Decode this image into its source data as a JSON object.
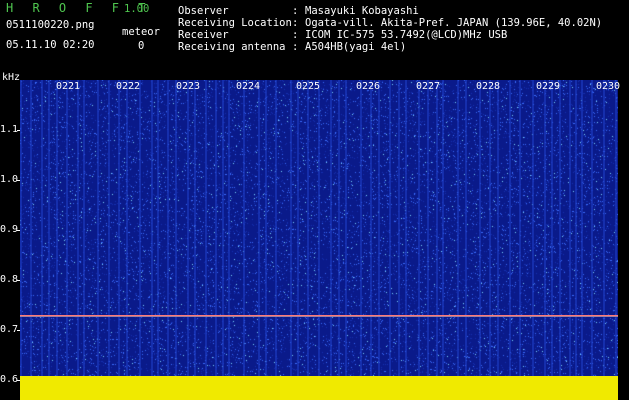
{
  "header": {
    "app_title": "H R O F F T",
    "version": "1.00",
    "filename": "0511100220.png",
    "datetime": "05.11.10 02:20",
    "meteor_label": "meteor",
    "meteor_count": "0",
    "info": [
      {
        "label": "Observer",
        "sep": ":",
        "value": "Masayuki Kobayashi"
      },
      {
        "label": "Receiving Location",
        "sep": ":",
        "value": "Ogata-vill. Akita-Pref. JAPAN (139.96E, 40.02N)"
      },
      {
        "label": "Receiver",
        "sep": ":",
        "value": "ICOM IC-575 53.7492(@LCD)MHz USB"
      },
      {
        "label": "Receiving antenna",
        "sep": ":",
        "value": "A504HB(yagi 4el)"
      }
    ]
  },
  "spectrogram": {
    "y_unit": "kHz",
    "y_ticks": [
      "1.1",
      "1.0",
      "0.9",
      "0.8",
      "0.7",
      "0.6"
    ],
    "x_ticks": [
      "0221",
      "0222",
      "0223",
      "0224",
      "0225",
      "0226",
      "0227",
      "0228",
      "0229",
      "0230"
    ],
    "signal_line_khz": 0.73,
    "colors": {
      "background": "#0a1a8a",
      "noise": "#3a6cff",
      "signal": "#ff4040",
      "floor": "#f0ea00",
      "title_green": "#4fc64f"
    }
  }
}
